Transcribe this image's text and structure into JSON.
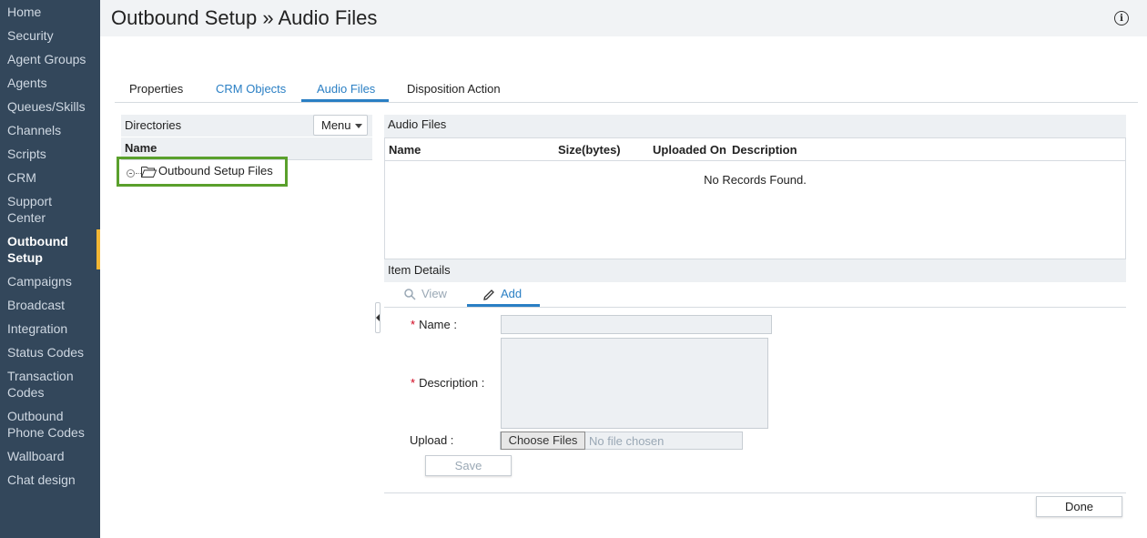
{
  "sidebar": {
    "items": [
      {
        "label": "Home"
      },
      {
        "label": "Security"
      },
      {
        "label": "Agent Groups"
      },
      {
        "label": "Agents"
      },
      {
        "label": "Queues/Skills"
      },
      {
        "label": "Channels"
      },
      {
        "label": "Scripts"
      },
      {
        "label": "CRM"
      },
      {
        "label": "Support Center"
      },
      {
        "label": "Outbound Setup",
        "active": true
      },
      {
        "label": "Campaigns"
      },
      {
        "label": "Broadcast"
      },
      {
        "label": "Integration"
      },
      {
        "label": "Status Codes"
      },
      {
        "label": "Transaction Codes"
      },
      {
        "label": "Outbound Phone Codes"
      },
      {
        "label": "Wallboard"
      },
      {
        "label": "Chat design"
      }
    ],
    "accent_color": "#f2b634",
    "background_color": "#33475b"
  },
  "header": {
    "title": "Outbound Setup » Audio Files",
    "info_icon": "info-icon"
  },
  "tabs": [
    {
      "label": "Properties"
    },
    {
      "label": "CRM Objects"
    },
    {
      "label": "Audio Files",
      "active": true
    },
    {
      "label": "Disposition Action"
    }
  ],
  "directories": {
    "title": "Directories",
    "menu_label": "Menu",
    "column_name": "Name",
    "tree": [
      {
        "label": "Outbound Setup Files",
        "icon": "folder-open-icon"
      }
    ]
  },
  "audio_files": {
    "title": "Audio Files",
    "columns": [
      "Name",
      "Size(bytes)",
      "Uploaded On",
      "Description"
    ],
    "empty_message": "No Records Found."
  },
  "item_details": {
    "title": "Item Details",
    "tabs": [
      {
        "label": "View",
        "icon": "search-icon"
      },
      {
        "label": "Add",
        "icon": "pencil-icon",
        "active": true
      }
    ],
    "form": {
      "required_marker": "*",
      "name_label": "Name :",
      "name_value": "",
      "description_label": "Description :",
      "description_value": "",
      "upload_label": "Upload :",
      "choose_files_label": "Choose Files",
      "no_file_text": "No file chosen",
      "save_label": "Save"
    }
  },
  "footer": {
    "done_label": "Done"
  },
  "colors": {
    "link_blue": "#2a7fc4",
    "highlight_green": "#5aa02c",
    "required_red": "#d0021b"
  }
}
